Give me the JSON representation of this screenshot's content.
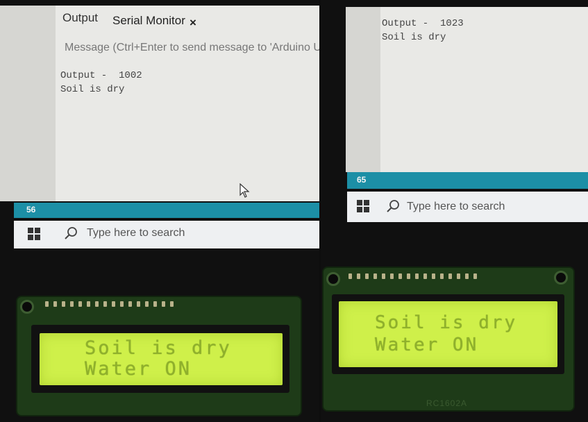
{
  "left_photo": {
    "ide": {
      "tabs": {
        "output": "Output",
        "serial_monitor": "Serial Monitor"
      },
      "close_glyph": "×",
      "message_placeholder": "Message (Ctrl+Enter to send message to 'Arduino U",
      "serial_lines": [
        "Output -  1002",
        "Soil is dry"
      ],
      "status_line_number": "56"
    },
    "taskbar": {
      "search_placeholder": "Type here to search"
    },
    "lcd": {
      "line1": "Soil is dry",
      "line2": "Water ON"
    }
  },
  "right_photo": {
    "ide": {
      "serial_lines": [
        "Output -  1023",
        "Soil is dry"
      ],
      "status_line_number": "65"
    },
    "taskbar": {
      "search_placeholder": "Type here to search"
    },
    "lcd": {
      "line1": "Soil is dry",
      "line2": "Water ON",
      "model": "RC1602A"
    }
  },
  "colors": {
    "ide_status_bar": "#1c8fa6",
    "lcd_backlight": "#cff04a",
    "lcd_text": "#8fb02c",
    "pcb": "#1e3b18"
  },
  "icons": [
    "windows-logo-icon",
    "search-icon",
    "mouse-cursor-icon"
  ]
}
